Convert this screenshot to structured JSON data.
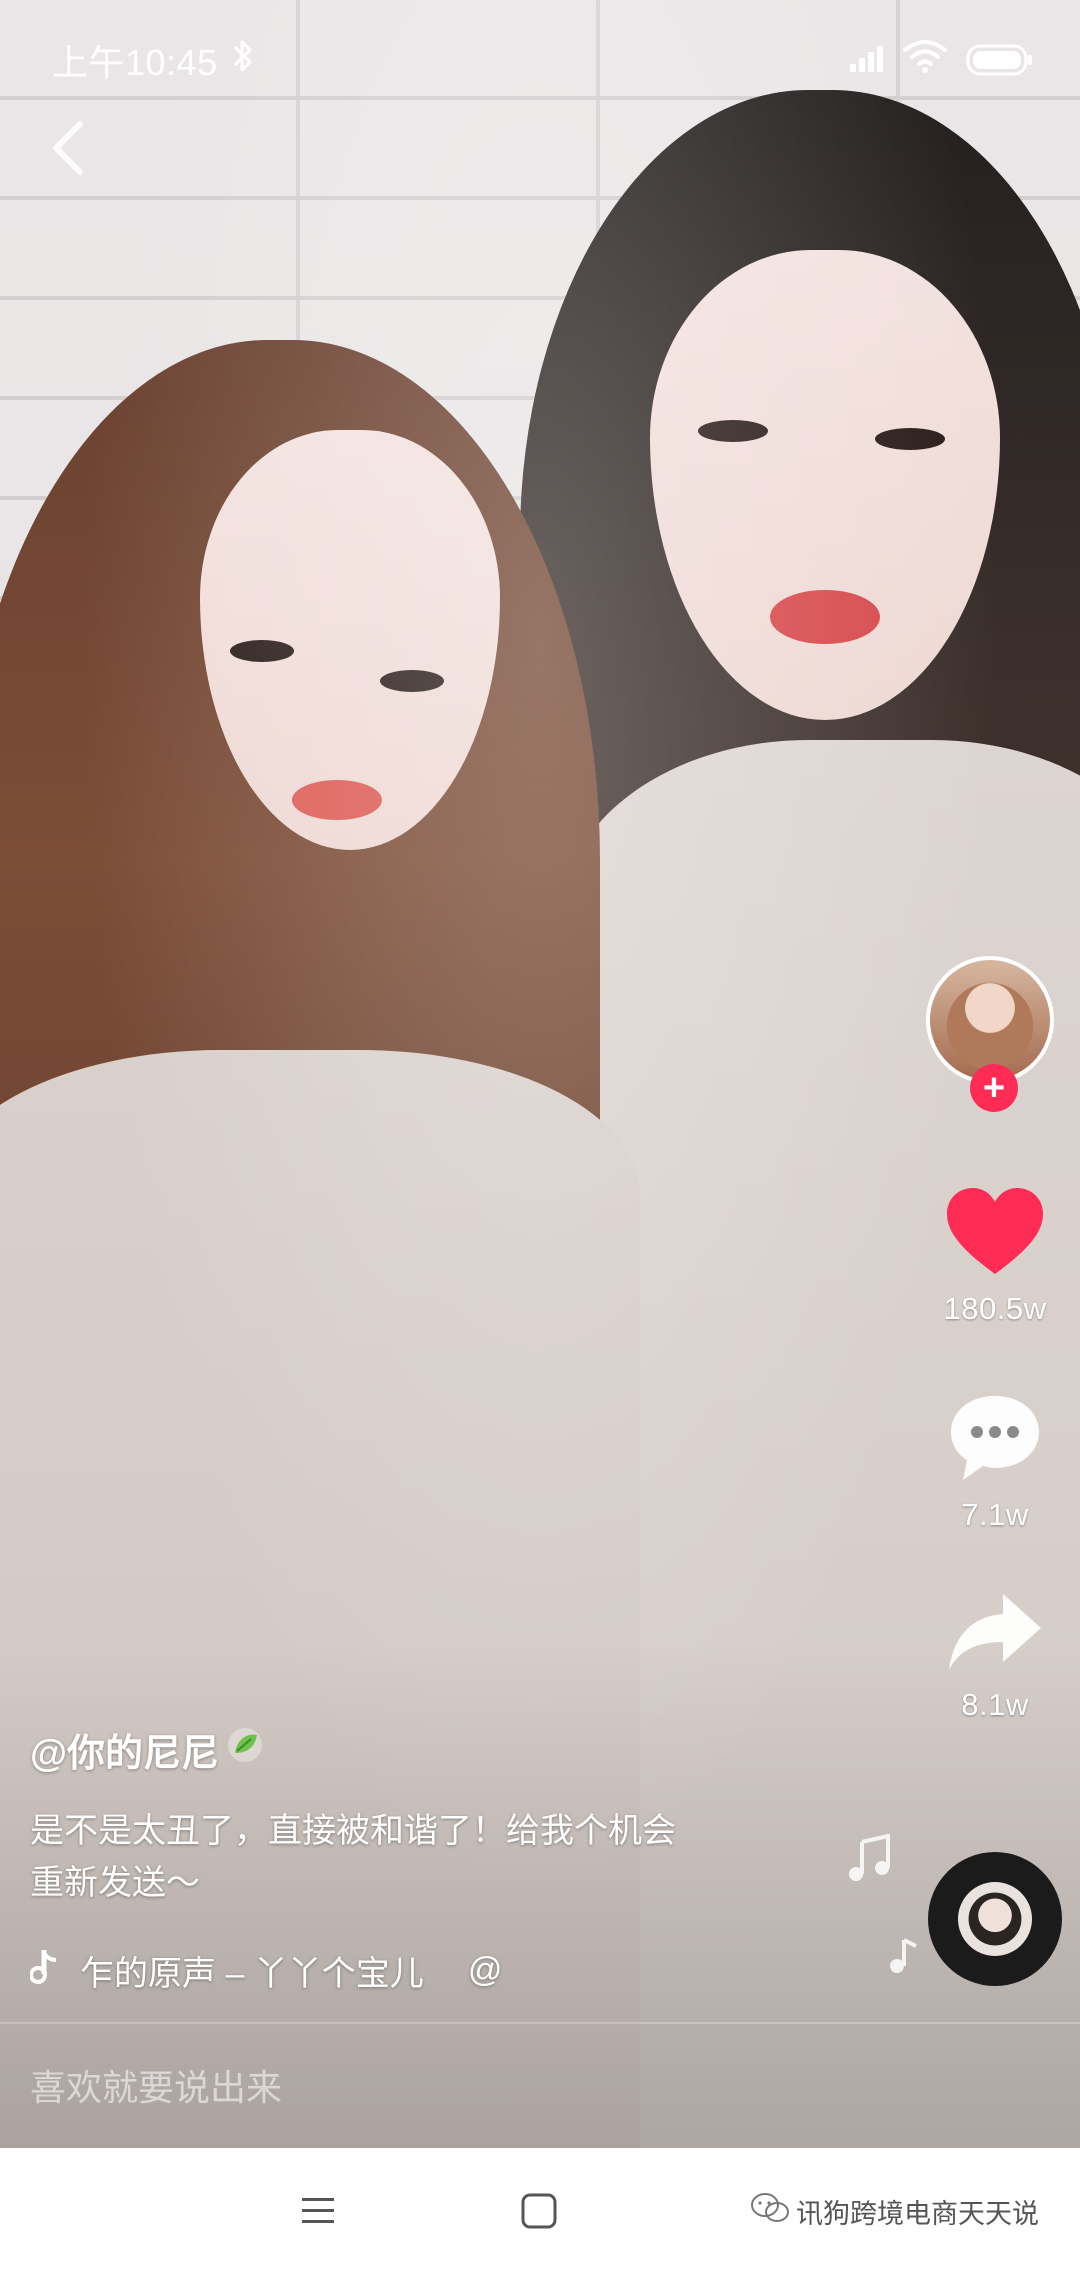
{
  "status_bar": {
    "time": "上午10:45"
  },
  "video": {
    "description_icon": "back-arrow-icon"
  },
  "author": {
    "username": "@你的尼尼",
    "caption_line1": "是不是太丑了，直接被和谐了！给我个机会",
    "caption_line2": "重新发送～"
  },
  "music": {
    "title": "乍的原声 – 丫丫个宝儿",
    "mention": "@"
  },
  "actions": {
    "likes": "180.5w",
    "comments": "7.1w",
    "shares": "8.1w"
  },
  "comment_input": {
    "placeholder": "喜欢就要说出来"
  },
  "watermark": {
    "text": "讯狗跨境电商天天说"
  },
  "colors": {
    "like_red": "#fe2c55",
    "follow_red": "#fe2c55",
    "nav_bg": "#ffffff"
  }
}
